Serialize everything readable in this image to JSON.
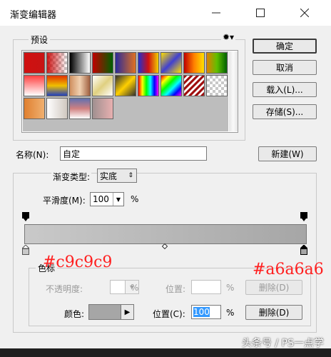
{
  "window": {
    "title": "渐变编辑器",
    "minimize_icon": "minimize-icon",
    "maximize_icon": "maximize-icon",
    "close_icon": "close-icon"
  },
  "buttons": {
    "ok": "确定",
    "cancel": "取消",
    "load": "载入(L)...",
    "save": "存储(S)...",
    "new": "新建(W)"
  },
  "presets": {
    "label": "预设",
    "gear_icon": "gear-icon",
    "swatches": [
      "linear-gradient(90deg,#d01010,#c81414)",
      "checker-red",
      "linear-gradient(90deg,#000,#fff)",
      "linear-gradient(90deg,#c00000,#006000)",
      "linear-gradient(90deg,#2a2a9a,#e07020)",
      "linear-gradient(90deg,#2030d0,#d01010,#f0d000)",
      "linear-gradient(135deg,#ffe000,#4040d0,#ffe000)",
      "linear-gradient(90deg,#c00000,#ff8000,#ffe000)",
      "linear-gradient(90deg,#e08000,#60c000,#006000)",
      "linear-gradient(180deg,#ff4040,#ffa0a0,#fff)",
      "linear-gradient(180deg,#e03000,#f0c000,#2040c0)",
      "linear-gradient(90deg,#d09060,#f0d0b0,#a06040)",
      "linear-gradient(135deg,#fff,#e0d080,#fff)",
      "linear-gradient(135deg,#303030,#ffd000,#303030)",
      "linear-gradient(90deg,#ff0000,#ffff00,#00ff00,#00ffff,#0000ff,#ff00ff)",
      "linear-gradient(135deg,#ff0000,#ffff00,#00ff00,#00ffff,#0000ff,#ff00ff)",
      "repeating-linear-gradient(135deg,#a01010 0 3px,#fff 3px 6px)",
      "checker-plain",
      "linear-gradient(90deg,#e08030,#f0b070)",
      "linear-gradient(90deg,#fff,#d0c8c0)",
      "linear-gradient(180deg,#6070b0,#d08080,#fff)",
      "linear-gradient(90deg,#a09090,#e8b0b0)"
    ]
  },
  "name": {
    "label": "名称(N):",
    "value": "自定"
  },
  "gradient_type": {
    "label": "渐变类型:",
    "value": "实底",
    "icon": "updown-arrows-icon"
  },
  "smoothness": {
    "label": "平滑度(M):",
    "value": "100",
    "unit": "%",
    "icon": "dropdown-arrow-icon"
  },
  "stops_group": {
    "label": "色标",
    "opacity_label": "不透明度:",
    "opacity_unit": "%",
    "opacity_location_label": "位置:",
    "opacity_location_unit": "%",
    "opacity_delete": "删除(D)",
    "color_label": "颜色:",
    "color_swatch": "#a6a6a6",
    "color_location_label": "位置(C):",
    "color_location_value": "100",
    "color_location_unit": "%",
    "color_delete": "删除(D)"
  },
  "gradient": {
    "start_color": "#c9c9c9",
    "end_color": "#a6a6a6"
  },
  "annotations": {
    "left": "#c9c9c9",
    "right": "#a6a6a6"
  },
  "watermark": "头条号 / PS一点学"
}
